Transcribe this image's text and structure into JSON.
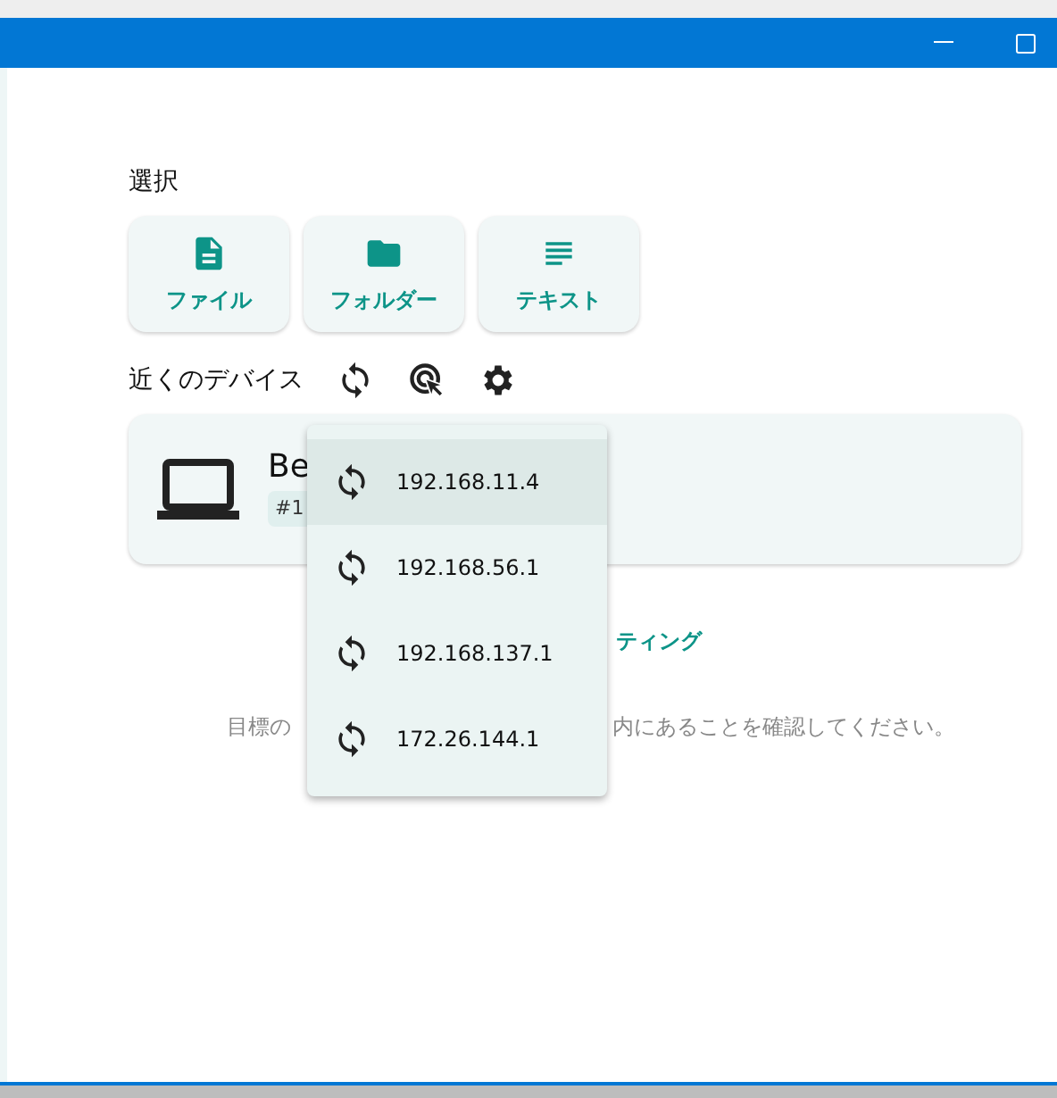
{
  "select_section": {
    "title": "選択",
    "buttons": [
      {
        "kind": "file",
        "label": "ファイル"
      },
      {
        "kind": "folder",
        "label": "フォルダー"
      },
      {
        "kind": "text",
        "label": "テキスト"
      }
    ]
  },
  "nearby_section": {
    "title": "近くのデバイス",
    "tools": [
      {
        "kind": "refresh"
      },
      {
        "kind": "target"
      },
      {
        "kind": "settings"
      }
    ]
  },
  "device": {
    "name": "Be",
    "tag": "#1"
  },
  "link_fragment": "ティング",
  "hint_left": "目標の",
  "hint_right": "内にあることを確認してください。",
  "dropdown": [
    {
      "label": "192.168.11.4",
      "hovered": true
    },
    {
      "label": "192.168.56.1",
      "hovered": false
    },
    {
      "label": "192.168.137.1",
      "hovered": false
    },
    {
      "label": "172.26.144.1",
      "hovered": false
    }
  ]
}
